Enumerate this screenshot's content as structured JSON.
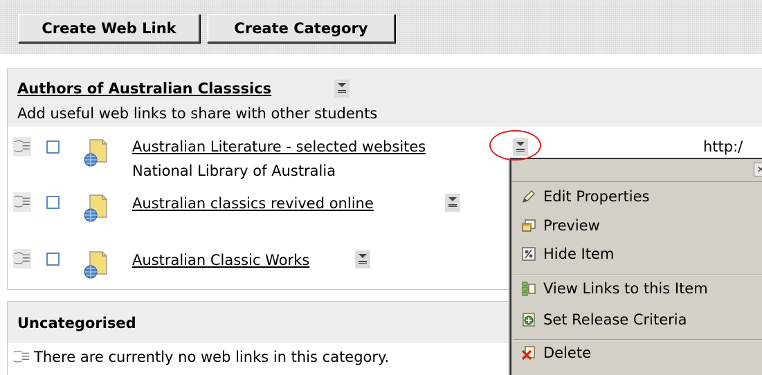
{
  "toolbar": {
    "create_web_link": "Create Web Link",
    "create_category": "Create Category"
  },
  "category1": {
    "title": "Authors of Australian Classsics",
    "description": "Add useful web links to share with other students",
    "links": [
      {
        "title": "Australian Literature - selected websites",
        "subtitle": "National Library of Australia",
        "url_fragment": "http:/"
      },
      {
        "title": "Australian classics revived online",
        "subtitle": ""
      },
      {
        "title": "Australian Classic Works",
        "subtitle": ""
      }
    ]
  },
  "category2": {
    "title": "Uncategorised",
    "empty_message": "There are currently no web links in this category."
  },
  "context_menu": {
    "close": "×",
    "items": [
      {
        "label": "Edit Properties",
        "icon": "pencil-icon"
      },
      {
        "label": "Preview",
        "icon": "preview-window-icon"
      },
      {
        "label": "Hide Item",
        "icon": "hide-item-icon"
      },
      {
        "label": "View Links to this Item",
        "icon": "view-links-icon"
      },
      {
        "label": "Set Release Criteria",
        "icon": "release-criteria-icon"
      },
      {
        "label": "Delete",
        "icon": "delete-x-icon"
      }
    ]
  },
  "colors": {
    "highlight": "#e02020",
    "checkbox_border": "#5b87c9",
    "menu_bg": "#d4d0c8"
  }
}
